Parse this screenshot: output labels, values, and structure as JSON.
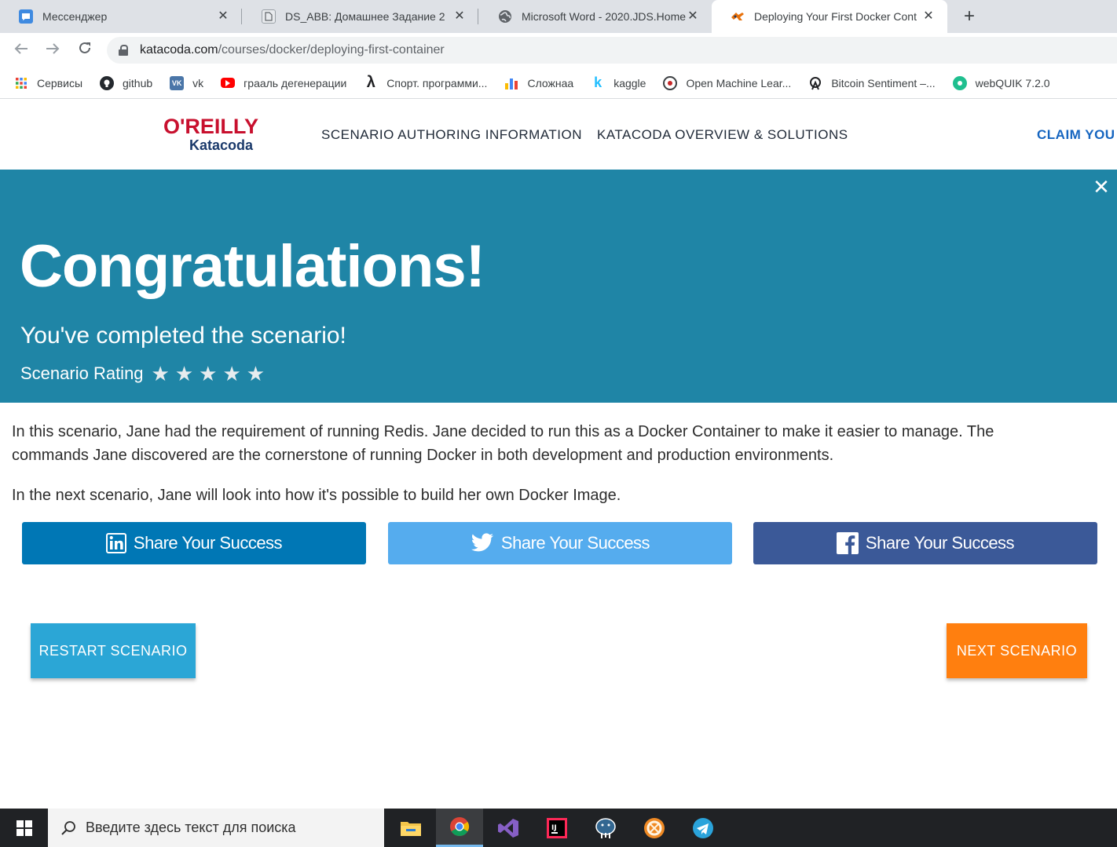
{
  "browser": {
    "tabs": [
      {
        "title": "Мессенджер",
        "icon": "messenger-icon",
        "color": "#3f8ae0"
      },
      {
        "title": "DS_ABB: Домашнее Задание 2",
        "icon": "page-icon",
        "color": "#5f6368"
      },
      {
        "title": "Microsoft Word - 2020.JDS.Home",
        "icon": "globe-icon",
        "color": "#5f6368"
      },
      {
        "title": "Deploying Your First Docker Cont",
        "icon": "katacoda-icon",
        "color": "#e8710a"
      }
    ],
    "new_tab": "+",
    "url_host": "katacoda.com",
    "url_path": "/courses/docker/deploying-first-container",
    "bookmarks": [
      {
        "label": "Сервисы",
        "icon": "apps-grid-icon"
      },
      {
        "label": "github",
        "icon": "github-icon"
      },
      {
        "label": "vk",
        "icon": "vk-icon"
      },
      {
        "label": "грааль дегенерации",
        "icon": "youtube-icon"
      },
      {
        "label": "Спорт. программи...",
        "icon": "lambda-icon"
      },
      {
        "label": "Сложнаа",
        "icon": "bar-chart-icon"
      },
      {
        "label": "kaggle",
        "icon": "kaggle-icon"
      },
      {
        "label": "Open Machine Lear...",
        "icon": "openml-icon"
      },
      {
        "label": "Bitcoin Sentiment –...",
        "icon": "bitcoin-sentiment-icon"
      },
      {
        "label": "webQUIK 7.2.0",
        "icon": "webquik-icon"
      }
    ]
  },
  "site": {
    "logo_top": "O'REILLY",
    "logo_bottom": "Katacoda",
    "nav": [
      "SCENARIO AUTHORING INFORMATION",
      "KATACODA OVERVIEW & SOLUTIONS"
    ],
    "claim": "CLAIM YOU"
  },
  "banner": {
    "heading": "Congratulations!",
    "subheading": "You've completed the scenario!",
    "rating_label": "Scenario Rating",
    "stars": 5,
    "close": "✕",
    "color": "#1f85a6"
  },
  "content": {
    "paragraph1": "In this scenario, Jane had the requirement of running Redis. Jane decided to run this as a Docker Container to make it easier to manage. The commands Jane discovered are the cornerstone of running Docker in both development and production environments.",
    "paragraph2": "In the next scenario, Jane will look into how it's possible to build her own Docker Image."
  },
  "share": [
    {
      "label": "Share Your Success",
      "network": "linkedin",
      "color": "#0077b5"
    },
    {
      "label": "Share Your Success",
      "network": "twitter",
      "color": "#55acee"
    },
    {
      "label": "Share Your Success",
      "network": "facebook",
      "color": "#3b5998"
    }
  ],
  "actions": {
    "restart": "RESTART SCENARIO",
    "next": "NEXT SCENARIO",
    "restart_color": "#2ba6d6",
    "next_color": "#ff7f0f"
  },
  "taskbar": {
    "search_placeholder": "Введите здесь текст для поиска",
    "apps": [
      "file-explorer-icon",
      "chrome-icon",
      "visual-studio-icon",
      "intellij-icon",
      "pgadmin-icon",
      "app-orange-icon",
      "telegram-icon"
    ]
  }
}
